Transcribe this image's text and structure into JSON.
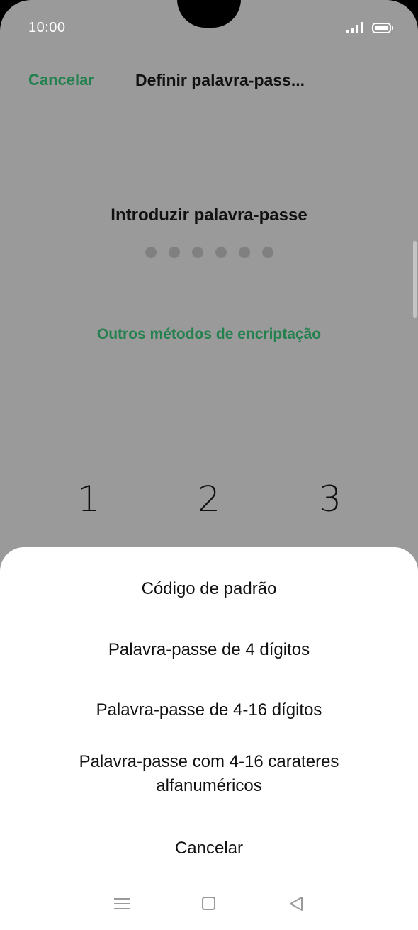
{
  "status_bar": {
    "time": "10:00"
  },
  "header": {
    "cancel_label": "Cancelar",
    "title": "Definir palavra-pass..."
  },
  "prompt": "Introduzir palavra-passe",
  "pin_length": 6,
  "other_methods_link": "Outros métodos de encriptação",
  "keypad": {
    "keys": [
      "1",
      "2",
      "3"
    ]
  },
  "sheet": {
    "options": [
      "Código de padrão",
      "Palavra-passe de 4 dígitos",
      "Palavra-passe de 4-16 dígitos",
      "Palavra-passe com 4-16 carateres alfanuméricos"
    ],
    "cancel_label": "Cancelar"
  },
  "colors": {
    "accent": "#23804f",
    "overlay_bg": "#9a9a9a"
  },
  "nav_icons": [
    "menu-icon",
    "home-icon",
    "back-icon"
  ]
}
